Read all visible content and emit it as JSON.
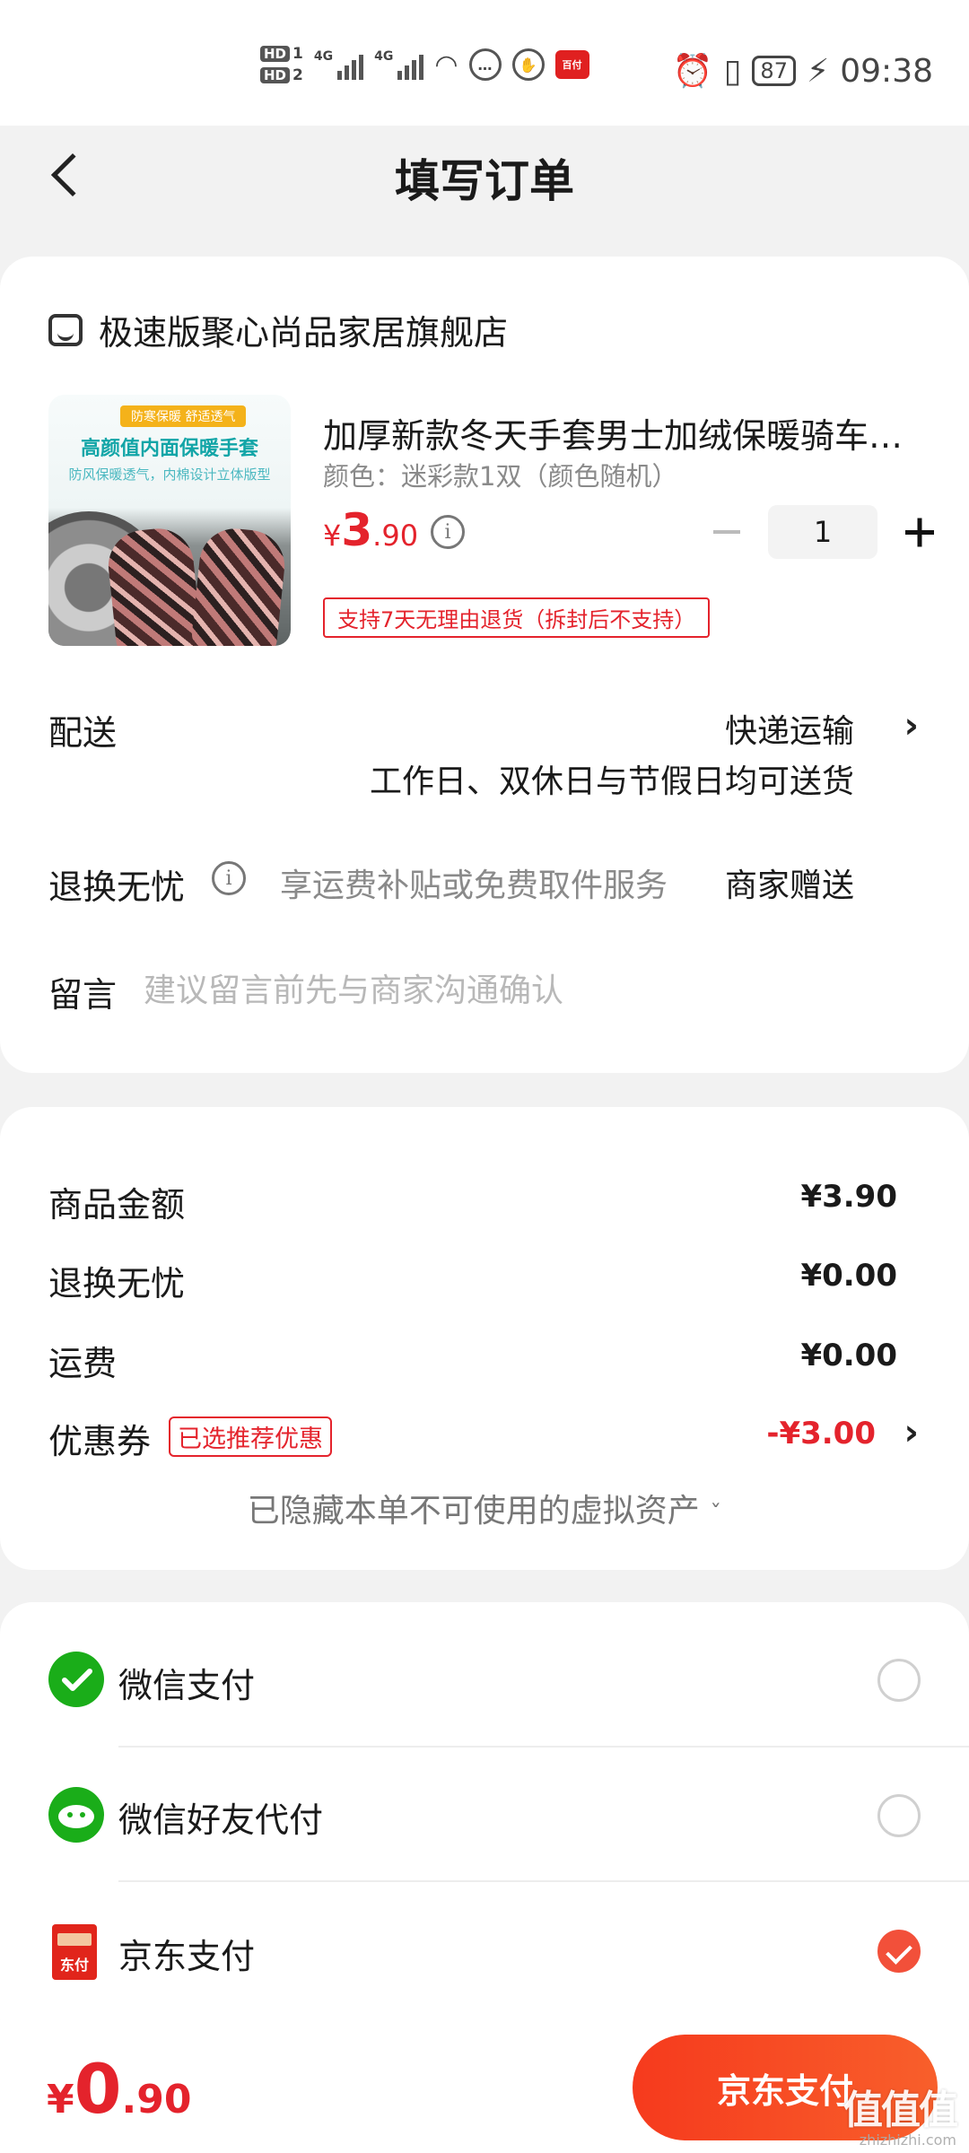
{
  "status_bar": {
    "hd1": "HD",
    "hd1_num": "1",
    "hd2": "HD",
    "hd2_num": "2",
    "net1": "4G",
    "net2": "4G",
    "app_badge": "百付",
    "battery": "87",
    "time": "09:38"
  },
  "header": {
    "title": "填写订单"
  },
  "store": {
    "name": "极速版聚心尚品家居旗舰店"
  },
  "product": {
    "image_tag": "防寒保暖 舒适透气",
    "image_headline": "高颜值内面保暖手套",
    "image_sub": "防风保暖透气，内棉设计立体版型",
    "title": "加厚新款冬天手套男士加绒保暖骑车…",
    "spec": "颜色：迷彩款1双（颜色随机）",
    "price_currency": "¥",
    "price_int": "3",
    "price_dec": ".90",
    "quantity": "1",
    "return_badge": "支持7天无理由退货（拆封后不支持）"
  },
  "delivery": {
    "label": "配送",
    "method": "快递运输",
    "note": "工作日、双休日与节假日均可送货"
  },
  "return_service": {
    "label": "退换无忧",
    "desc": "享运费补贴或免费取件服务",
    "value": "商家赠送"
  },
  "message": {
    "label": "留言",
    "placeholder": "建议留言前先与商家沟通确认",
    "value": ""
  },
  "summary": {
    "goods_label": "商品金额",
    "goods_value": "¥3.90",
    "return_label": "退换无忧",
    "return_value": "¥0.00",
    "shipping_label": "运费",
    "shipping_value": "¥0.00",
    "coupon_label": "优惠券",
    "coupon_tag": "已选推荐优惠",
    "coupon_value": "-¥3.00",
    "hidden_assets": "已隐藏本单不可使用的虚拟资产"
  },
  "payment": {
    "options": [
      {
        "label": "微信支付",
        "icon": "wechat-pay-icon",
        "selected": false
      },
      {
        "label": "微信好友代付",
        "icon": "wechat-friend-pay-icon",
        "selected": false
      },
      {
        "label": "京东支付",
        "icon": "jd-pay-icon",
        "selected": true
      }
    ],
    "jd_icon_text": "东付"
  },
  "bottom": {
    "currency": "¥",
    "total_int": "0",
    "total_dec": ".90",
    "pay_button": "京东支付"
  },
  "watermark": {
    "big": "值值值",
    "small": "zhizhizhi.com"
  },
  "colors": {
    "accent_red": "#e4232c",
    "pay_button": "#f63a1d",
    "wechat_green": "#1aad19",
    "radio_checked": "#f2503a"
  }
}
